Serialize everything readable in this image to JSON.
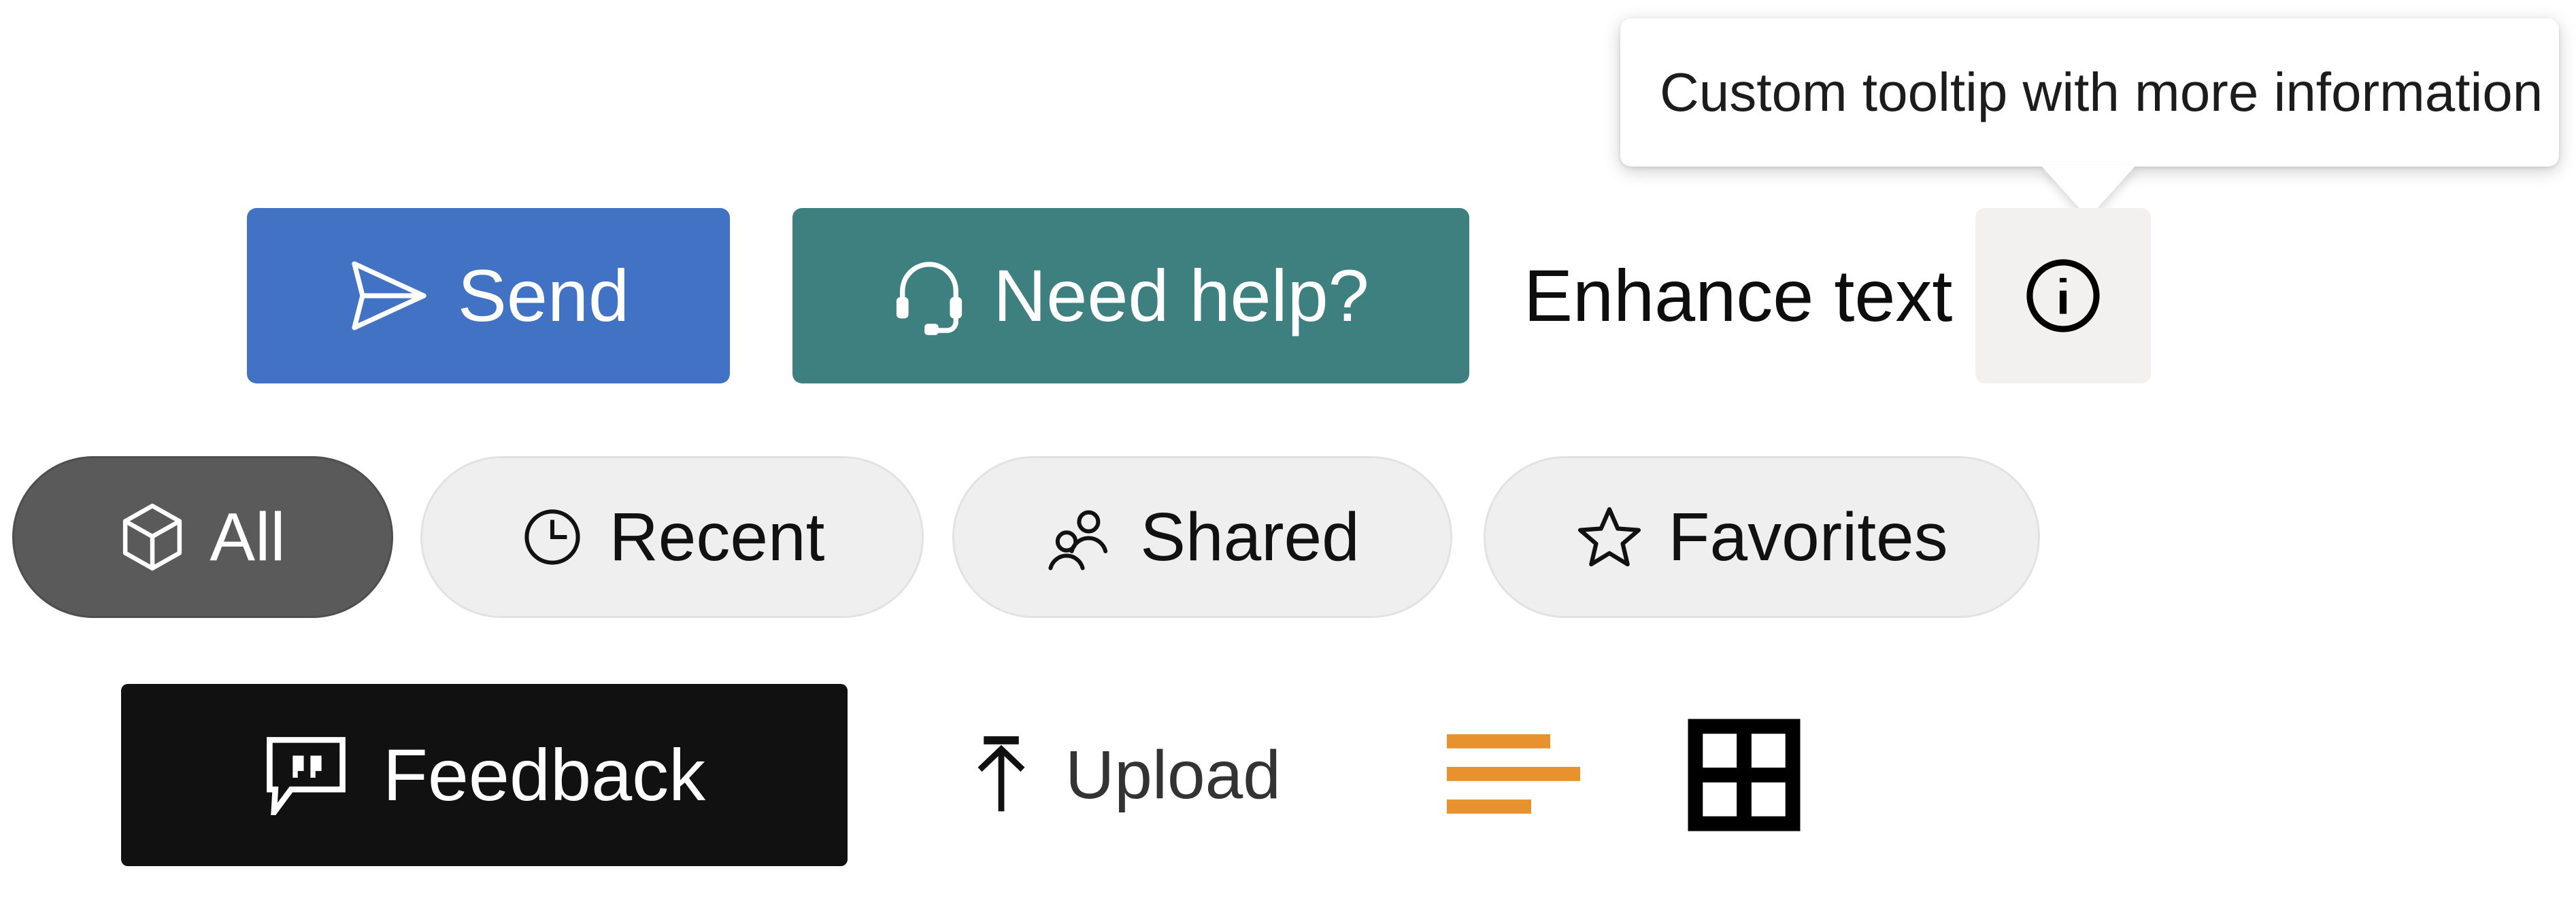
{
  "tooltip": {
    "text": "Custom tooltip with more information",
    "anchor": "info-button",
    "position": "above",
    "background": "#ffffff"
  },
  "actions": {
    "send": {
      "label": "Send",
      "icon": "send-icon",
      "background": "#4172c3",
      "text_color": "#ffffff"
    },
    "help": {
      "label": "Need help?",
      "icon": "headset-icon",
      "background": "#3e7f80",
      "text_color": "#ffffff"
    },
    "enhance": {
      "label": "Enhance text",
      "text_color": "#0d0d0d"
    },
    "info": {
      "icon": "info-circle-icon",
      "background": "#f2f1ef",
      "icon_color": "#000000"
    }
  },
  "filters": {
    "items": [
      {
        "label": "All",
        "icon": "cube-icon",
        "selected": true,
        "background": "#5a5a5a",
        "text_color": "#ffffff"
      },
      {
        "label": "Recent",
        "icon": "clock-icon",
        "selected": false,
        "background": "#efefef",
        "text_color": "#111111"
      },
      {
        "label": "Shared",
        "icon": "people-icon",
        "selected": false,
        "background": "#efefef",
        "text_color": "#111111"
      },
      {
        "label": "Favorites",
        "icon": "star-icon",
        "selected": false,
        "background": "#efefef",
        "text_color": "#111111"
      }
    ]
  },
  "tools": {
    "feedback": {
      "label": "Feedback",
      "icon": "speech-bubble-quote-icon",
      "background": "#111111",
      "text_color": "#ffffff"
    },
    "upload": {
      "label": "Upload",
      "icon": "upload-arrow-icon",
      "text_color": "#333333"
    },
    "list_view": {
      "icon": "list-lines-icon",
      "icon_color": "#e8912f",
      "line_count": 3
    },
    "grid_view": {
      "icon": "grid-2x2-icon",
      "icon_color": "#000000",
      "cells": 4
    }
  }
}
